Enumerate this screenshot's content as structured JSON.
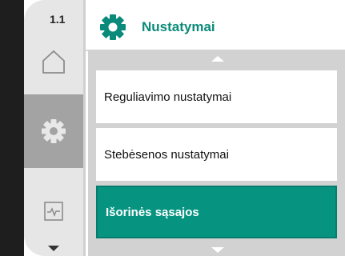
{
  "sidebar": {
    "menu_number": "1.1",
    "items": [
      {
        "name": "home",
        "icon": "home-icon"
      },
      {
        "name": "settings",
        "icon": "gear-icon",
        "active": true
      },
      {
        "name": "diagnostics",
        "icon": "diagnostics-icon"
      }
    ]
  },
  "header": {
    "title": "Nustatymai",
    "icon": "gear-icon",
    "accent_color": "#0a8a7a"
  },
  "menu": {
    "items": [
      {
        "label": "Reguliavimo nustatymai",
        "selected": false
      },
      {
        "label": "Stebėsenos nustatymai",
        "selected": false
      },
      {
        "label": "Išorinės sąsajos",
        "selected": true
      }
    ]
  },
  "colors": {
    "selected_bg": "#069481",
    "active_sidebar_bg": "#a3a3a3"
  }
}
